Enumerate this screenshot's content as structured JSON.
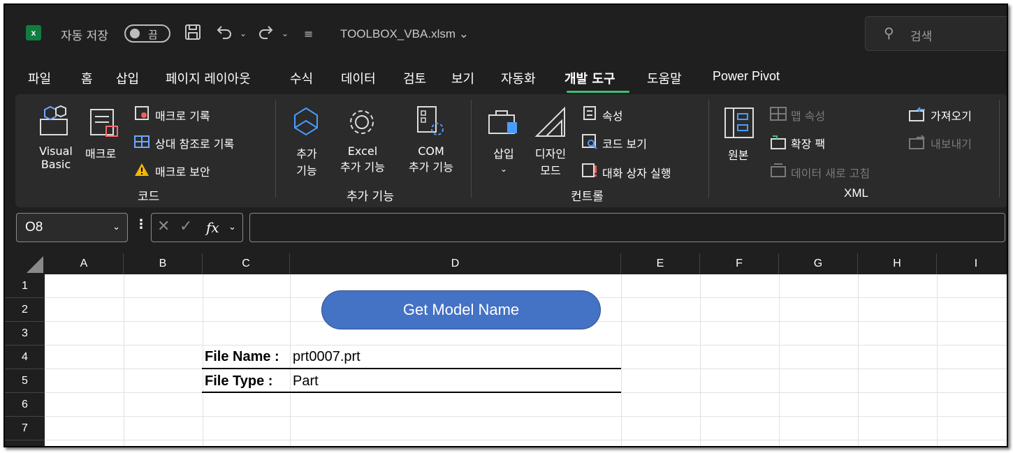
{
  "titlebar": {
    "autosave_label": "자동 저장",
    "autosave_state": "끔",
    "filename": "TOOLBOX_VBA.xlsm",
    "search_placeholder": "검색"
  },
  "tabs": [
    {
      "label": "파일"
    },
    {
      "label": "홈"
    },
    {
      "label": "삽입"
    },
    {
      "label": "페이지 레이아웃"
    },
    {
      "label": "수식"
    },
    {
      "label": "데이터"
    },
    {
      "label": "검토"
    },
    {
      "label": "보기"
    },
    {
      "label": "자동화"
    },
    {
      "label": "개발 도구",
      "active": true
    },
    {
      "label": "도움말"
    },
    {
      "label": "Power Pivot"
    }
  ],
  "ribbon": {
    "code": {
      "group": "코드",
      "visual_basic_1": "Visual",
      "visual_basic_2": "Basic",
      "macro": "매크로",
      "record_macro": "매크로 기록",
      "relative_ref": "상대 참조로 기록",
      "macro_security": "매크로 보안"
    },
    "addins": {
      "group": "추가 기능",
      "addin_1": "추가",
      "addin_2": "기능",
      "excel_addin_1": "Excel",
      "excel_addin_2": "추가 기능",
      "com_addin_1": "COM",
      "com_addin_2": "추가 기능"
    },
    "controls": {
      "group": "컨트롤",
      "insert": "삽입",
      "design_mode_1": "디자인",
      "design_mode_2": "모드",
      "properties": "속성",
      "view_code": "코드 보기",
      "run_dialog": "대화 상자 실행"
    },
    "xml": {
      "group": "XML",
      "source": "원본",
      "map_properties": "맵 속성",
      "expansion_packs": "확장 팩",
      "refresh_data": "데이터 새로 고침",
      "import": "가져오기",
      "export": "내보내기"
    }
  },
  "formula_bar": {
    "name_box": "O8",
    "formula": ""
  },
  "grid": {
    "columns": [
      "A",
      "B",
      "C",
      "D",
      "E",
      "F",
      "G",
      "H",
      "I"
    ],
    "rows": [
      "1",
      "2",
      "3",
      "4",
      "5",
      "6",
      "7"
    ],
    "button_label": "Get Model Name",
    "file_name_label": "File Name :",
    "file_name_value": "prt0007.prt",
    "file_type_label": "File Type :",
    "file_type_value": "Part"
  },
  "colors": {
    "accent_tab_underline": "#3dbf7a",
    "button_fill": "#4472c4",
    "excel_green": "#107c41"
  }
}
